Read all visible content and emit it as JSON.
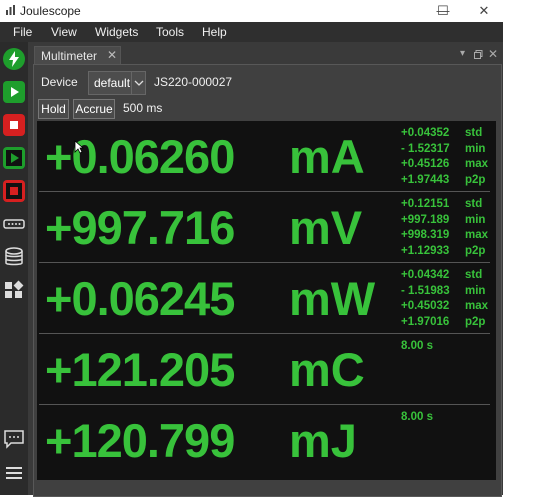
{
  "window": {
    "title": "Joulescope",
    "minimize": "—",
    "maximize": "☐",
    "close": "✕"
  },
  "menu": [
    "File",
    "View",
    "Widgets",
    "Tools",
    "Help"
  ],
  "left_toolbar": [
    "lightning-icon",
    "play-icon",
    "stop-icon",
    "record-icon",
    "record-stop-icon",
    "device-icon",
    "storage-icon",
    "widgets-icon",
    "chat-icon",
    "hamburger-menu-icon"
  ],
  "dock": {
    "tab_label": "Multimeter",
    "tab_close": "✕"
  },
  "controls": {
    "device_label": "Device",
    "device_value": "default",
    "serial": "JS220-000027",
    "hold_label": "Hold",
    "accrue_label": "Accrue",
    "duration": "500 ms"
  },
  "measurements": [
    {
      "value": "+0.06260",
      "unit": "mA",
      "stats": [
        {
          "v": "+0.04352",
          "l": "std"
        },
        {
          "v": "- 1.52317",
          "l": "min"
        },
        {
          "v": "+0.45126",
          "l": "max"
        },
        {
          "v": "+1.97443",
          "l": "p2p"
        }
      ]
    },
    {
      "value": "+997.716",
      "unit": "mV",
      "stats": [
        {
          "v": "+0.12151",
          "l": "std"
        },
        {
          "v": "+997.189",
          "l": "min"
        },
        {
          "v": "+998.319",
          "l": "max"
        },
        {
          "v": "+1.12933",
          "l": "p2p"
        }
      ]
    },
    {
      "value": "+0.06245",
      "unit": "mW",
      "stats": [
        {
          "v": "+0.04342",
          "l": "std"
        },
        {
          "v": "- 1.51983",
          "l": "min"
        },
        {
          "v": "+0.45032",
          "l": "max"
        },
        {
          "v": "+1.97016",
          "l": "p2p"
        }
      ]
    },
    {
      "value": "+121.205",
      "unit": "mC",
      "stats": [
        {
          "v": "8.00 s",
          "l": ""
        }
      ]
    },
    {
      "value": "+120.799",
      "unit": "mJ",
      "stats": [
        {
          "v": "8.00 s",
          "l": ""
        }
      ]
    }
  ],
  "colors": {
    "value_green": "#38c23b",
    "display_bg": "#111111",
    "toolbar_green": "#1e9e2c",
    "toolbar_red": "#d62020"
  }
}
